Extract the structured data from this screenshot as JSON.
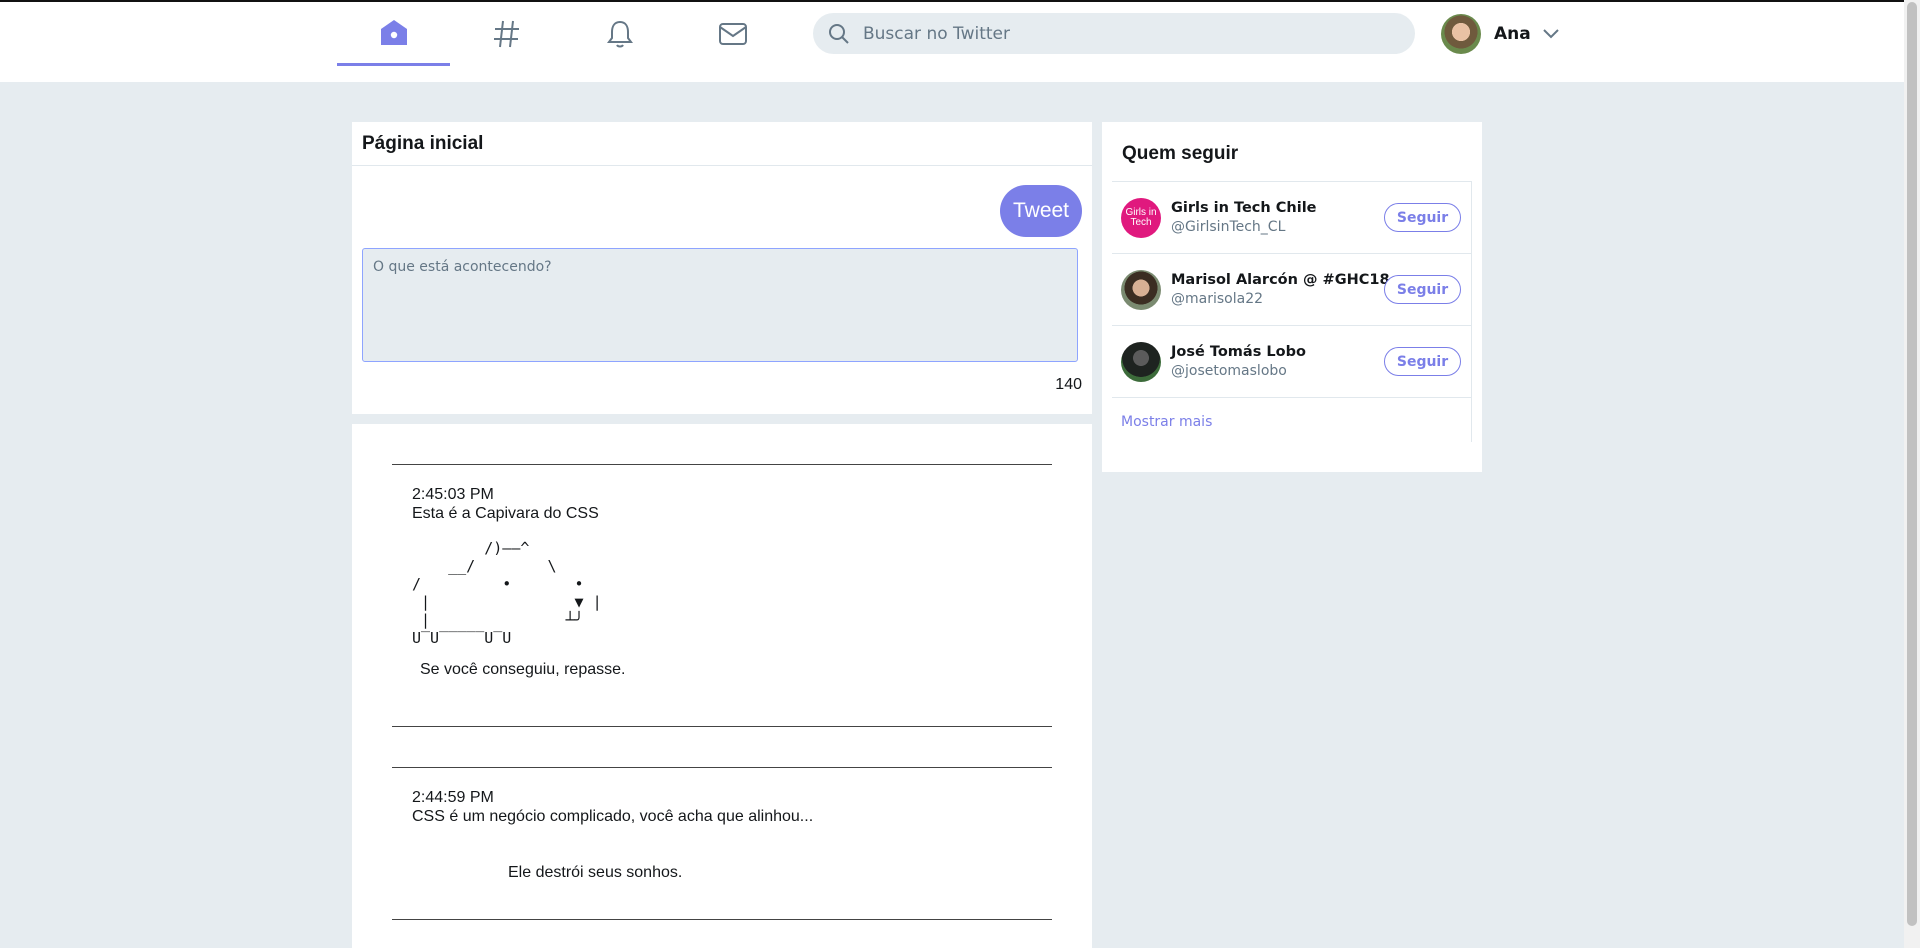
{
  "nav": {
    "items": [
      {
        "icon": "home-icon",
        "label": "Home"
      },
      {
        "icon": "hashtag-icon",
        "label": "Explorar"
      },
      {
        "icon": "bell-icon",
        "label": "Notificações"
      },
      {
        "icon": "mail-icon",
        "label": "Mensagens"
      }
    ],
    "accent": "#7b7fe8"
  },
  "search": {
    "placeholder": "Buscar no Twitter"
  },
  "user": {
    "name": "Ana"
  },
  "home": {
    "title": "Página inicial",
    "tweet_button": "Tweet",
    "compose_placeholder": "O que está acontecendo?",
    "char_counter": "140"
  },
  "feed": {
    "posts": [
      {
        "time": "2:45:03 PM",
        "text": "Esta é a Capivara do CSS",
        "ascii": "        /)——^\n    __/        \\\n/         •       •\n |                ▼ |\n |               ┴╯\nU‾U‾‾‾‾‾U‾U",
        "footer": "Se você conseguiu, repasse."
      },
      {
        "time": "2:44:59 PM",
        "text": "CSS é um negócio complicado, você acha que alinhou...",
        "footer": "Ele destrói seus sonhos."
      }
    ]
  },
  "who_to_follow": {
    "title": "Quem seguir",
    "users": [
      {
        "name": "Girls in Tech Chile",
        "handle": "@GirlsinTech_CL",
        "avatar_text": "Girls in Tech",
        "avatar_color": "#e0197e"
      },
      {
        "name": "Marisol Alarcón @ #GHC18",
        "handle": "@marisola22",
        "avatar_color": "#6b5a43"
      },
      {
        "name": "José Tomás Lobo",
        "handle": "@josetomaslobo",
        "avatar_color": "#2a2f2c"
      }
    ],
    "follow_label": "Seguir",
    "show_more": "Mostrar mais"
  }
}
